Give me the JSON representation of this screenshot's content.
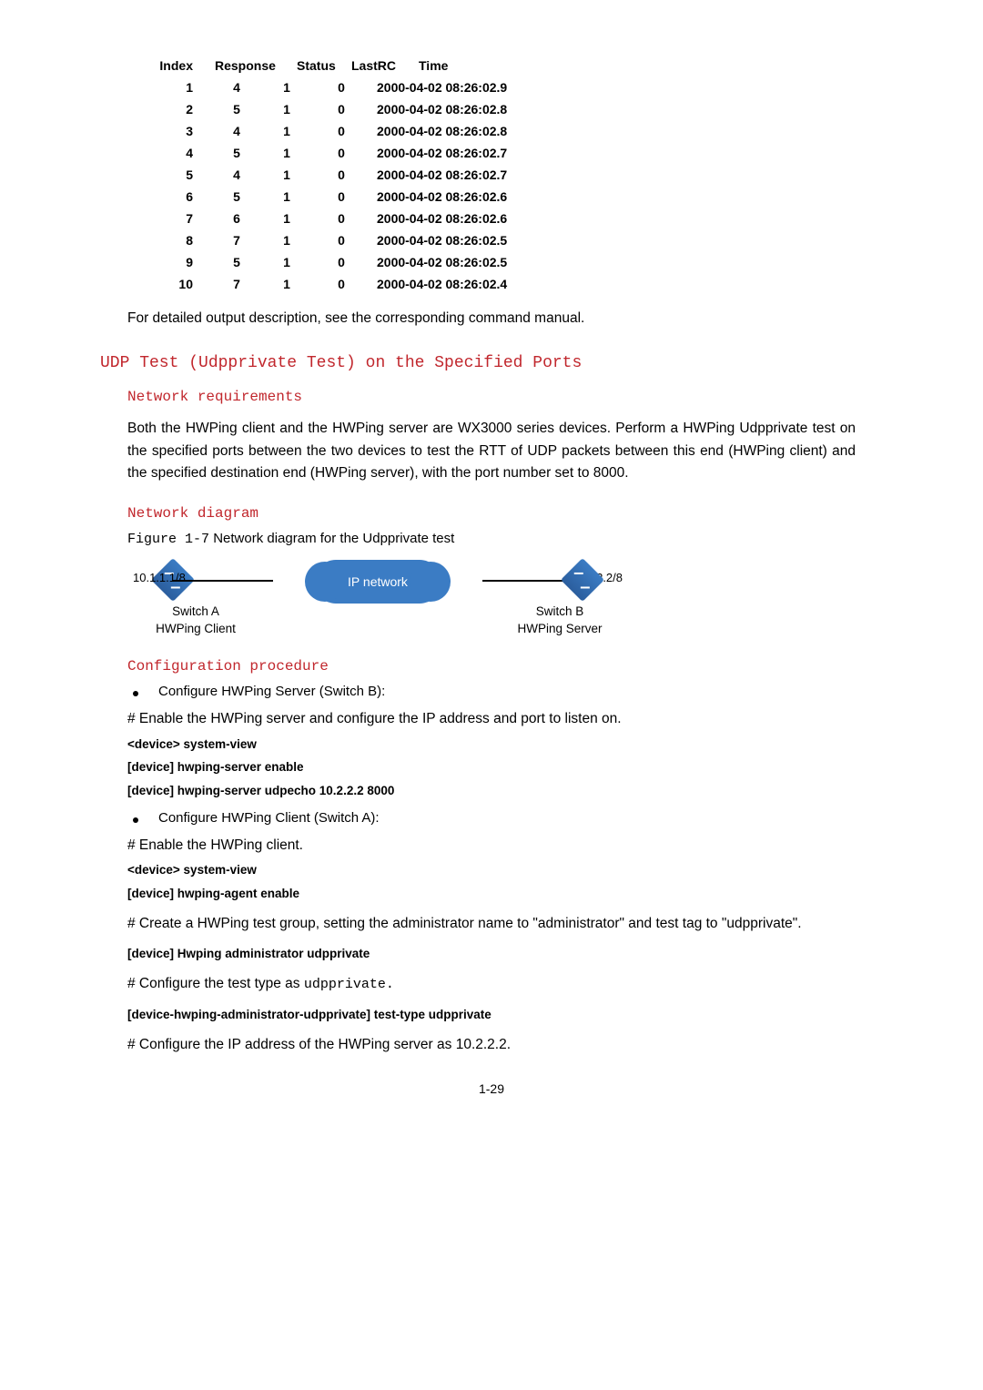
{
  "table": {
    "headers": {
      "index": "Index",
      "response": "Response",
      "status": "Status",
      "lastrc": "LastRC",
      "time": "Time"
    },
    "rows": [
      {
        "index": "1",
        "r1": "4",
        "r2": "1",
        "status": "0",
        "time": "2000-04-02 08:26:02.9"
      },
      {
        "index": "2",
        "r1": "5",
        "r2": "1",
        "status": "0",
        "time": "2000-04-02 08:26:02.8"
      },
      {
        "index": "3",
        "r1": "4",
        "r2": "1",
        "status": "0",
        "time": "2000-04-02 08:26:02.8"
      },
      {
        "index": "4",
        "r1": "5",
        "r2": "1",
        "status": "0",
        "time": "2000-04-02 08:26:02.7"
      },
      {
        "index": "5",
        "r1": "4",
        "r2": "1",
        "status": "0",
        "time": "2000-04-02 08:26:02.7"
      },
      {
        "index": "6",
        "r1": "5",
        "r2": "1",
        "status": "0",
        "time": "2000-04-02 08:26:02.6"
      },
      {
        "index": "7",
        "r1": "6",
        "r2": "1",
        "status": "0",
        "time": "2000-04-02 08:26:02.6"
      },
      {
        "index": "8",
        "r1": "7",
        "r2": "1",
        "status": "0",
        "time": "2000-04-02 08:26:02.5"
      },
      {
        "index": "9",
        "r1": "5",
        "r2": "1",
        "status": "0",
        "time": "2000-04-02 08:26:02.5"
      },
      {
        "index": "10",
        "r1": "7",
        "r2": "1",
        "status": "0",
        "time": "2000-04-02 08:26:02.4"
      }
    ]
  },
  "p_detail": "For detailed output description, see the corresponding command manual.",
  "h2_udp": "UDP Test (Udpprivate Test) on the Specified Ports",
  "h3_req": "Network requirements",
  "p_req": "Both the HWPing client and the HWPing server are WX3000 series devices. Perform a HWPing Udpprivate test on the specified ports between the two devices to test the RTT of UDP packets between this end (HWPing client) and the specified destination end (HWPing server), with the port number set to 8000.",
  "h3_diag": "Network diagram",
  "fig": {
    "label": "Figure 1-7",
    "caption": "Network diagram for the Udpprivate test"
  },
  "diag": {
    "left_ip": "10.1.1.1/8",
    "right_ip": "10.2.2.2/8",
    "cloud": "IP network",
    "left_name": "Switch  A",
    "left_role": "HWPing Client",
    "right_name": "Switch  B",
    "right_role": "HWPing Server"
  },
  "h3_conf": "Configuration procedure",
  "bul_server": "Configure HWPing Server (Switch B):",
  "p_srv1": "# Enable the HWPing server and configure the IP address and port to listen on.",
  "cmd_srv1": "<device> system-view",
  "cmd_srv2": "[device] hwping-server enable",
  "cmd_srv3": "[device] hwping-server udpecho 10.2.2.2 8000",
  "bul_client": "Configure HWPing Client (Switch A):",
  "p_cli1": "# Enable the HWPing client.",
  "cmd_cli1": "<device> system-view",
  "cmd_cli2": "[device] hwping-agent enable",
  "p_cli2": "# Create a HWPing test group, setting the administrator name to \"administrator\" and test tag to \"udpprivate\".",
  "cmd_cli3": "[device] Hwping administrator udpprivate",
  "p_cli3_a": "# Configure the test type as ",
  "p_cli3_b": "udpprivate.",
  "cmd_cli4": "[device-hwping-administrator-udpprivate] test-type udpprivate",
  "p_cli4": "# Configure the IP address of the HWPing server as 10.2.2.2.",
  "pagenum": "1-29"
}
